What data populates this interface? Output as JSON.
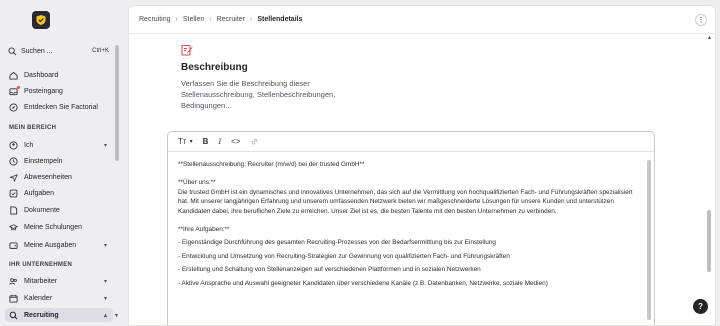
{
  "sidebar": {
    "search_label": "Suchen ...",
    "search_shortcut": "Ctrl+K",
    "top_items": [
      {
        "label": "Dashboard",
        "icon": "home-icon"
      },
      {
        "label": "Posteingang",
        "icon": "inbox-icon",
        "has_notification": true
      },
      {
        "label": "Entdecken Sie Factorial",
        "icon": "compass-icon"
      }
    ],
    "section_mein_bereich": "MEIN BEREICH",
    "mein_bereich_items": [
      {
        "label": "Ich",
        "chevron": true
      },
      {
        "label": "Einstempeln"
      },
      {
        "label": "Abwesenheiten"
      },
      {
        "label": "Aufgaben"
      },
      {
        "label": "Dokumente"
      },
      {
        "label": "Meine Schulungen"
      },
      {
        "label": "Meine Ausgaben",
        "chevron": true
      }
    ],
    "section_unternehmen": "IHR UNTERNEHMEN",
    "unternehmen_items": [
      {
        "label": "Mitarbeiter",
        "chevron": true
      },
      {
        "label": "Kalender",
        "chevron": true
      },
      {
        "label": "Recruiting",
        "chevron": true,
        "active": true
      }
    ]
  },
  "breadcrumb": [
    "Recruiting",
    "Stellen",
    "Recruiter",
    "Stellendetails"
  ],
  "section": {
    "title": "Beschreibung",
    "description": "Verfassen Sie die Beschreibung dieser Stellenausschreibung, Stellenbeschreibungen, Bedingungen..."
  },
  "editor": {
    "toolbar": {
      "text_style": "Tт",
      "bold": "B",
      "italic": "I",
      "code": "<>"
    },
    "lines": {
      "l1": "**Stellenausschreibung: Recruiter (m/w/d) bei der trusted GmbH**",
      "l2": "**Über uns:**",
      "l3": "Die trusted GmbH ist ein dynamisches und innovatives Unternehmen, das sich auf die Vermittlung von hochqualifizierten Fach- und Führungskräften spezialisiert hat. Mit unserer langjährigen Erfahrung und unserem umfassenden Netzwerk bieten wir maßgeschneiderte Lösungen für unsere Kunden und unterstützen Kandidaten dabei, ihre beruflichen Ziele zu erreichen. Unser Ziel ist es, die besten Talente mit den besten Unternehmen zu verbinden.",
      "l4": "**Ihre Aufgaben:**",
      "l5": "- Eigenständige Durchführung des gesamten Recruiting-Prozesses von der Bedarfsermittlung bis zur Einstellung",
      "l6": "- Entwicklung und Umsetzung von Recruiting-Strategien zur Gewinnung von qualifizierten Fach- und Führungskräften",
      "l7": "- Erstellung und Schaltung von Stellenanzeigen auf verschiedenen Plattformen und in sozialen Netzwerken",
      "l8": "- Aktive Ansprache und Auswahl geeigneter Kandidaten über verschiedene Kanäle (z.B. Datenbanken, Netzwerke, soziale Medien)"
    }
  },
  "help_label": "?",
  "colors": {
    "accent": "#e5484d",
    "logo_bg": "#2a2a35",
    "logo_check": "#f5c518"
  }
}
